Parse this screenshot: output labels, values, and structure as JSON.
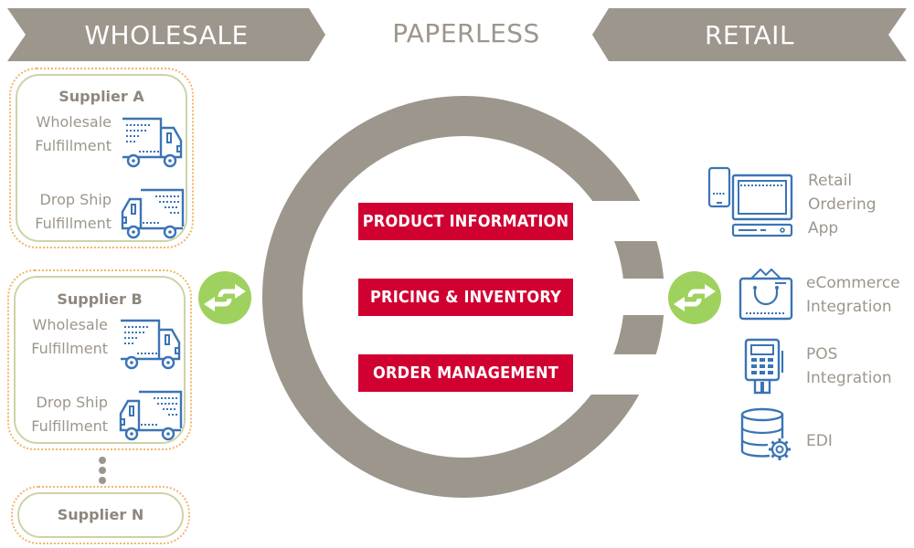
{
  "header": {
    "wholesale_label": "WHOLESALE",
    "center_label": "PAPERLESS",
    "retail_label": "RETAIL"
  },
  "colors": {
    "banner_gray": "#9d968c",
    "ring_gray": "#9d968c",
    "text_gray": "#9d968c",
    "accent_red": "#d00031",
    "swap_green": "#9fd15f",
    "icon_blue": "#3b74b5",
    "dotted_orange": "#f2b66a",
    "box_green": "#cdd3a8"
  },
  "suppliers": [
    {
      "name": "Supplier A",
      "fulfillment": [
        {
          "label_line1": "Wholesale",
          "label_line2": "Fulfillment",
          "icon": "box-truck-icon"
        },
        {
          "label_line1": "Drop Ship",
          "label_line2": "Fulfillment",
          "icon": "delivery-truck-icon"
        }
      ]
    },
    {
      "name": "Supplier B",
      "fulfillment": [
        {
          "label_line1": "Wholesale",
          "label_line2": "Fulfillment",
          "icon": "box-truck-icon"
        },
        {
          "label_line1": "Drop Ship",
          "label_line2": "Fulfillment",
          "icon": "delivery-truck-icon"
        }
      ]
    },
    {
      "name": "Supplier N",
      "fulfillment": []
    }
  ],
  "center": {
    "items": [
      {
        "label": "PRODUCT INFORMATION"
      },
      {
        "label": "PRICING & INVENTORY"
      },
      {
        "label": "ORDER MANAGEMENT"
      }
    ]
  },
  "retail": {
    "items": [
      {
        "label_line1": "Retail",
        "label_line2": "Ordering",
        "label_line3": "App",
        "icon": "computer-and-phone-icon"
      },
      {
        "label_line1": "eCommerce",
        "label_line2": "Integration",
        "icon": "shopping-bag-icon"
      },
      {
        "label_line1": "POS",
        "label_line2": "Integration",
        "icon": "pos-terminal-icon"
      },
      {
        "label_line1": "EDI",
        "icon": "database-gear-icon"
      }
    ]
  },
  "connectors": {
    "left_icon": "swap-arrows-icon",
    "right_icon": "swap-arrows-icon"
  }
}
